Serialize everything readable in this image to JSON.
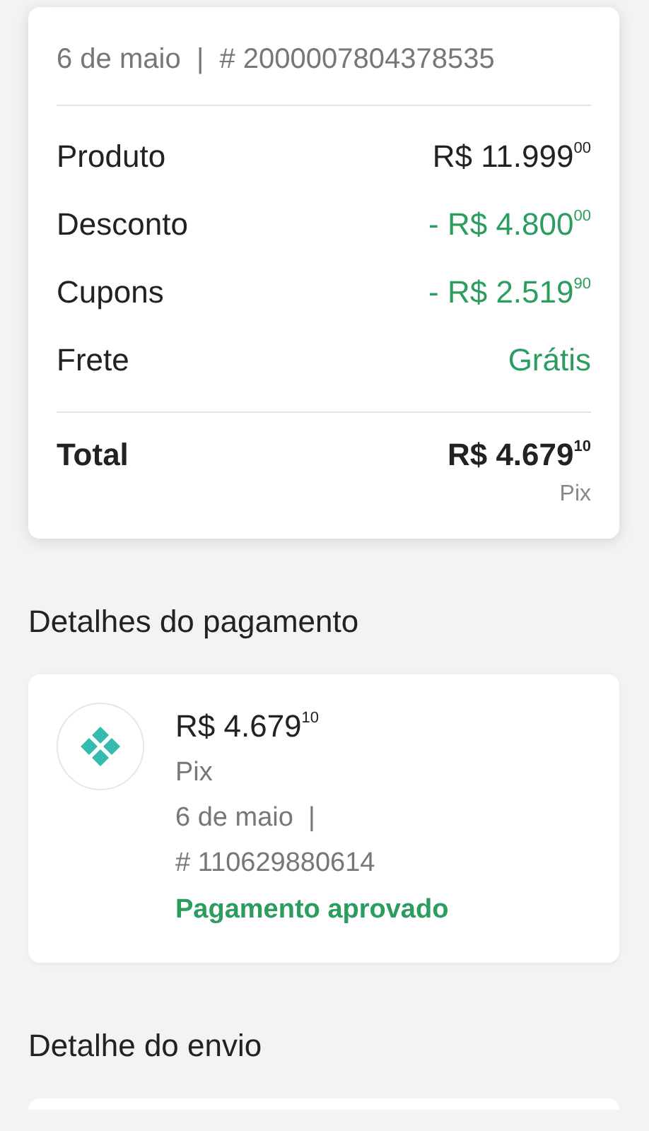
{
  "summary": {
    "header": "6 de maio  |  # 2000007804378535",
    "rows": [
      {
        "label": "Produto",
        "value": "R$ 11.999$^{00}$",
        "highlight": false
      },
      {
        "label": "Desconto",
        "value": "- R$ 4.800$^{00}$",
        "highlight": true
      },
      {
        "label": "Cupons",
        "value": "- R$ 2.519$^{90}$",
        "highlight": true
      },
      {
        "label": "Frete",
        "value": "Grátis",
        "highlight": true
      }
    ],
    "total": {
      "label": "Total",
      "value": "R$ 4.679$^{10}$",
      "method": "Pix"
    }
  },
  "payment": {
    "title": "Detalhes do pagamento",
    "amount": "R$ 4.679$^{10}$",
    "method": "Pix",
    "date": "6 de maio  |",
    "reference": "# 110629880614",
    "status": "Pagamento aprovado",
    "approved": true
  },
  "shipping": {
    "title": "Detalhe do envio"
  }
}
